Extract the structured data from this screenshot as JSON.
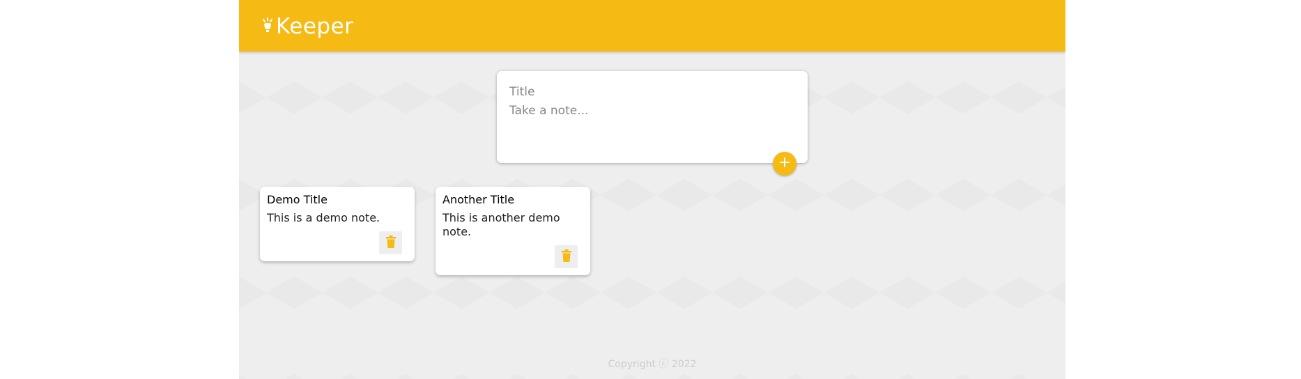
{
  "header": {
    "app_name": "Keeper",
    "logo_icon": "lightbulb-icon"
  },
  "composer": {
    "title_placeholder": "Title",
    "content_placeholder": "Take a note...",
    "add_icon": "plus-icon"
  },
  "notes": [
    {
      "title": "Demo Title",
      "content": "This is a demo note.",
      "delete_icon": "trash-icon"
    },
    {
      "title": "Another Title",
      "content": "This is another demo note.",
      "delete_icon": "trash-icon"
    }
  ],
  "footer": {
    "copyright": "Copyright ⓒ 2022"
  },
  "colors": {
    "accent": "#f5ba13",
    "background": "#eeeeee"
  }
}
